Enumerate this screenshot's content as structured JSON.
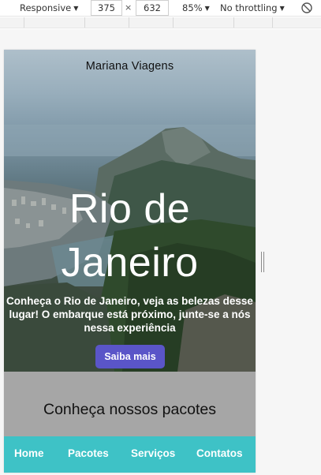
{
  "devtools": {
    "device": "Responsive",
    "width": "375",
    "height": "632",
    "separator": "×",
    "zoom": "85%",
    "throttling": "No throttling",
    "caret": "▼",
    "rotate_icon": "rotate-icon"
  },
  "site": {
    "brand": "Mariana Viagens",
    "hero": {
      "title": "Rio de Janeiro",
      "description": "Conheça o Rio de Janeiro, veja as belezas desse lugar! O embarque está próximo, junte-se a nós nessa experiência",
      "cta_label": "Saiba mais",
      "cta_color": "#5a55c8"
    },
    "packages": {
      "heading": "Conheça nossos pacotes",
      "background": "#a6a6a6"
    },
    "nav": {
      "background": "#3ec2c6",
      "items": [
        {
          "label": "Home"
        },
        {
          "label": "Pacotes"
        },
        {
          "label": "Serviços"
        },
        {
          "label": "Contatos"
        }
      ]
    }
  }
}
